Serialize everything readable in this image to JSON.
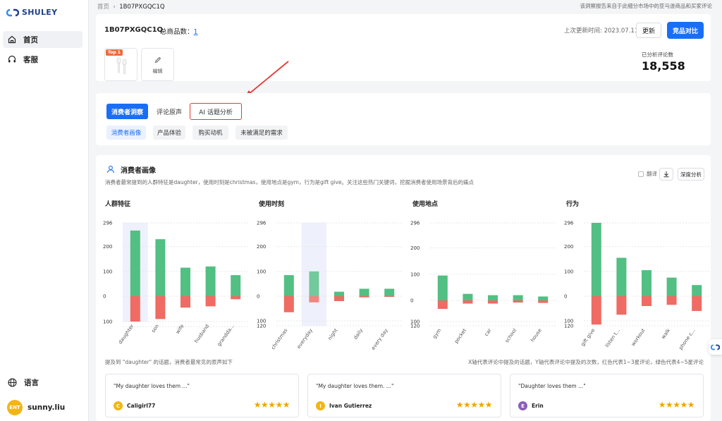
{
  "sidebar": {
    "logo": "SHULEY",
    "nav": [
      {
        "label": "首页",
        "icon": "home-icon",
        "active": true
      },
      {
        "label": "客服",
        "icon": "headset-icon",
        "active": false
      }
    ],
    "language_label": "语言",
    "user": {
      "avatar_text": "ENT",
      "name": "sunny.liu"
    }
  },
  "topbar": {
    "breadcrumb_home": "首页",
    "breadcrumb_current": "1B07PXGQC1Q",
    "note": "该洞察报告来自于此细分市场中的亚马逊商品和买家评论"
  },
  "header": {
    "asin": "1B07PXGQC1Q",
    "total_label": "总商品数：",
    "total_value": "1",
    "last_update": "上次更新时间: 2023.07.11",
    "update_button": "更新",
    "compare_button": "竞品对比",
    "top_badge": "Top 1",
    "edit_label": "编辑",
    "review_count_label": "已分析评论数",
    "review_count": "18,558"
  },
  "tabs": {
    "main": [
      "消费者洞察",
      "评论原声",
      "AI 话题分析"
    ],
    "sub": [
      "消费者画像",
      "产品体验",
      "购买动机",
      "未被满足的需求"
    ]
  },
  "persona": {
    "title": "消费者画像",
    "description": "消费者最常提到的人群特征是daughter，使用时刻是christmas，使用地点是gym，行为是gift give。关注这些热门关键词，挖掘消费者使用场景背后的痛点",
    "translate_label": "翻译",
    "deep_analysis": "深度分析",
    "footer_left": "提及到 \"daughter\" 的话题，消费者最常见的原声如下",
    "footer_right": "X轴代表评论中提及的话题，Y轴代表评论中提及的次数，红色代表1~3星评论，绿色代表4~5星评论"
  },
  "colors": {
    "green": "#52bf83",
    "red": "#ef6b63",
    "blue": "#1a6ef5",
    "highlight": "#eef1fb"
  },
  "chart_data": [
    {
      "type": "bar",
      "title": "人群特征",
      "categories": [
        "daughter",
        "son",
        "wife",
        "husband",
        "grandda..."
      ],
      "series": [
        {
          "values": [
            265,
            230,
            115,
            120,
            85
          ]
        },
        {
          "values": [
            -100,
            -90,
            -45,
            -40,
            -12
          ]
        }
      ],
      "yticks_pos": [
        "296",
        "200",
        "100",
        "0"
      ],
      "yticks_neg": [
        "100"
      ],
      "highlight_index": 0
    },
    {
      "type": "bar",
      "title": "使用时刻",
      "categories": [
        "christmas",
        "everyday",
        "night",
        "daily",
        "every day"
      ],
      "series": [
        {
          "values": [
            85,
            100,
            18,
            30,
            30
          ]
        },
        {
          "values": [
            -65,
            -25,
            -20,
            -5,
            -3
          ]
        }
      ],
      "yticks_pos": [
        "296",
        "200",
        "100",
        "0"
      ],
      "yticks_neg": [
        "100",
        "120"
      ],
      "highlight_index": 1
    },
    {
      "type": "bar",
      "title": "使用地点",
      "categories": [
        "gym",
        "pocket",
        "car",
        "school",
        "house"
      ],
      "series": [
        {
          "values": [
            95,
            25,
            20,
            20,
            15
          ]
        },
        {
          "values": [
            -40,
            -15,
            -15,
            -10,
            -12
          ]
        }
      ],
      "yticks_pos": [
        "296",
        "200",
        "100",
        "0"
      ],
      "yticks_neg": [
        "100",
        "120"
      ],
      "highlight_index": -1
    },
    {
      "type": "bar",
      "title": "行为",
      "categories": [
        "gift give",
        "listen t...",
        "workout",
        "walk",
        "phone c..."
      ],
      "series": [
        {
          "values": [
            296,
            155,
            105,
            75,
            45
          ]
        },
        {
          "values": [
            -115,
            -75,
            -40,
            -35,
            -60
          ]
        }
      ],
      "yticks_pos": [
        "296",
        "200",
        "100",
        "0"
      ],
      "yticks_neg": [
        "100",
        "120"
      ],
      "highlight_index": -1
    }
  ],
  "reviews": [
    {
      "quote": "\"My daughter loves them ...\"",
      "initial": "C",
      "name": "Caligirl77",
      "color": "#f3b515",
      "stars": "★★★★★"
    },
    {
      "quote": "\"My daughter loves them. ...\"",
      "initial": "I",
      "name": "Ivan Gutierrez",
      "color": "#f3b515",
      "stars": "★★★★★"
    },
    {
      "quote": "\"Daughter loves them ...\"",
      "initial": "E",
      "name": "Erin",
      "color": "#8a5fb8",
      "stars": "★★★★★"
    }
  ]
}
